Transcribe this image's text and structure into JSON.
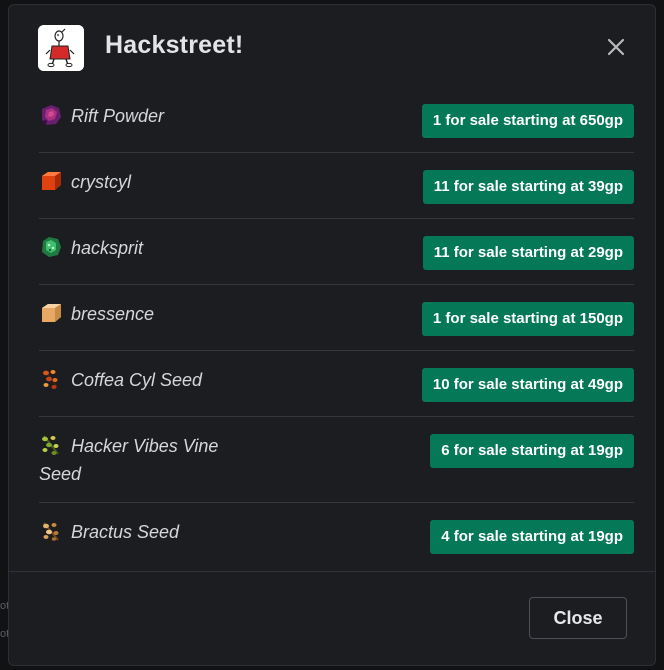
{
  "modal": {
    "title": "Hackstreet!",
    "close_button_label": "Close"
  },
  "items": [
    {
      "name": "Rift Powder",
      "icon": "rift-powder-icon",
      "listing": "1 for sale starting at 650gp"
    },
    {
      "name": "crystcyl",
      "icon": "crystcyl-icon",
      "listing": "11 for sale starting at 39gp"
    },
    {
      "name": "hacksprit",
      "icon": "hacksprit-icon",
      "listing": "11 for sale starting at 29gp"
    },
    {
      "name": "bressence",
      "icon": "bressence-icon",
      "listing": "1 for sale starting at 150gp"
    },
    {
      "name": "Coffea Cyl Seed",
      "icon": "coffea-cyl-seed-icon",
      "listing": "10 for sale starting at 49gp"
    },
    {
      "name": "Hacker Vibes Vine Seed",
      "icon": "hacker-vibes-vine-seed-icon",
      "listing": "6 for sale starting at 19gp"
    },
    {
      "name": "Bractus Seed",
      "icon": "bractus-seed-icon",
      "listing": "4 for sale starting at 19gp"
    }
  ],
  "colors": {
    "modal_bg": "#1b1d21",
    "badge_bg": "#047857",
    "text": "#d6d7d9"
  }
}
